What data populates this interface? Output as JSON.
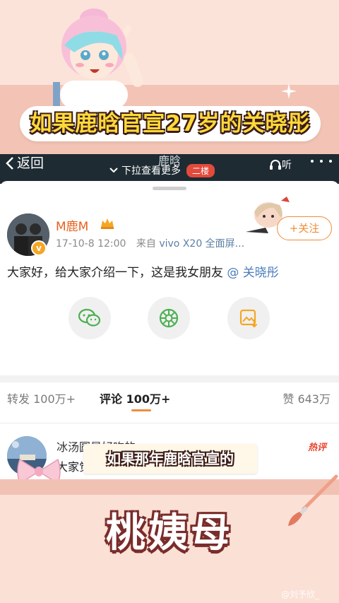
{
  "banner": {
    "title": "如果鹿晗官宣27岁的关晓彤"
  },
  "nav": {
    "back_label": "返回",
    "title": "鹿晗",
    "pull_hint": "下拉查看更多",
    "floor_badge": "二楼",
    "listen_label": "听"
  },
  "post": {
    "user_name": "M鹿M",
    "verified_label": "v",
    "timestamp": "17-10-8 12:00",
    "source_prefix": "来自",
    "device": "vivo X20 全面屏...",
    "follow_label": "+关注",
    "text": "大家好，给大家介绍一下，这是我女朋友",
    "mention": "@ 关晓彤"
  },
  "tabs": {
    "repost": "转发 100万+",
    "comment": "评论 100万+",
    "like": "赞 643万"
  },
  "comment": {
    "user": "冰汤圆是好吃的 yu",
    "hot_tag": "热评",
    "text": "大家觉得是假的点赞"
  },
  "caption": "如果那年鹿晗官宣的",
  "big_title": "桃姨母",
  "watermark": "@刘予欣_",
  "colors": {
    "accent": "#f08c3a",
    "nav_bg": "#1e2b33",
    "badge_red": "#e24a3b",
    "banner_pink": "#f3c4b5",
    "title_yellow": "#ffd93a"
  }
}
